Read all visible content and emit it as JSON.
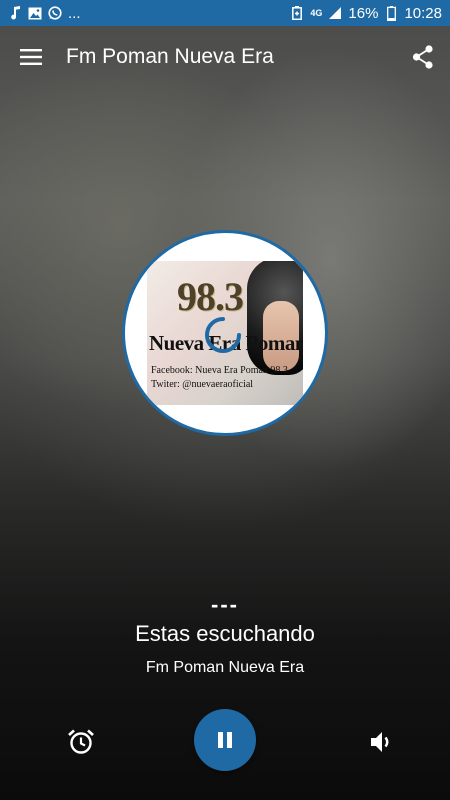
{
  "status_bar": {
    "overflow_indicator": "...",
    "network_type": "4G",
    "battery": "16%",
    "time": "10:28",
    "icons": [
      "music-note-icon",
      "image-icon",
      "whatsapp-icon",
      "battery-saver-icon",
      "signal-icon",
      "battery-icon"
    ]
  },
  "app_bar": {
    "title": "Fm Poman Nueva Era",
    "menu_icon": "hamburger-menu-icon",
    "share_icon": "share-icon"
  },
  "cover": {
    "frequency": "98.3",
    "name": "Nueva Era Poman",
    "facebook": "Facebook: Nueva Era Poman 98.3",
    "twitter": "Twiter: @nuevaeraoficial",
    "loading_icon": "loading-spinner-icon"
  },
  "now_playing": {
    "track": "---",
    "status": "Estas escuchando",
    "station": "Fm Poman Nueva Era"
  },
  "controls": {
    "alarm_icon": "alarm-clock-icon",
    "play_pause_icon": "pause-icon",
    "volume_icon": "volume-icon"
  },
  "colors": {
    "accent": "#1f6aa5",
    "text": "#ffffff"
  }
}
